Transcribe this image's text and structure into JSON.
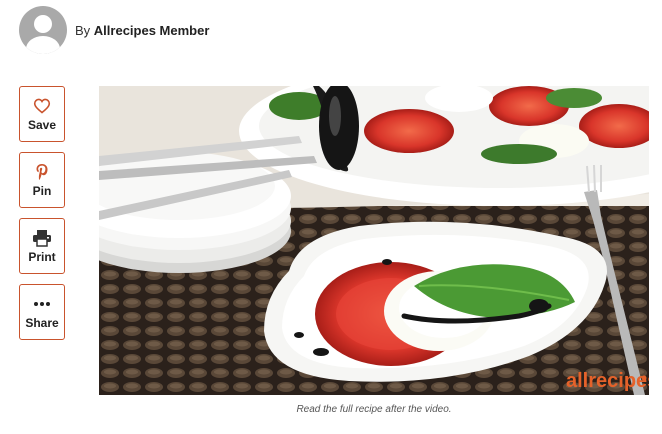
{
  "byline": {
    "prefix": "By",
    "author": "Allrecipes Member"
  },
  "actions": [
    {
      "label": "Save",
      "icon": "heart-icon"
    },
    {
      "label": "Pin",
      "icon": "pinterest-icon"
    },
    {
      "label": "Print",
      "icon": "printer-icon"
    },
    {
      "label": "Share",
      "icon": "more-dots-icon"
    }
  ],
  "video": {
    "watermark": "allrecipes"
  },
  "caption": "Read the full recipe after the video.",
  "colors": {
    "accent": "#c9532d",
    "brand": "#e5622a"
  }
}
